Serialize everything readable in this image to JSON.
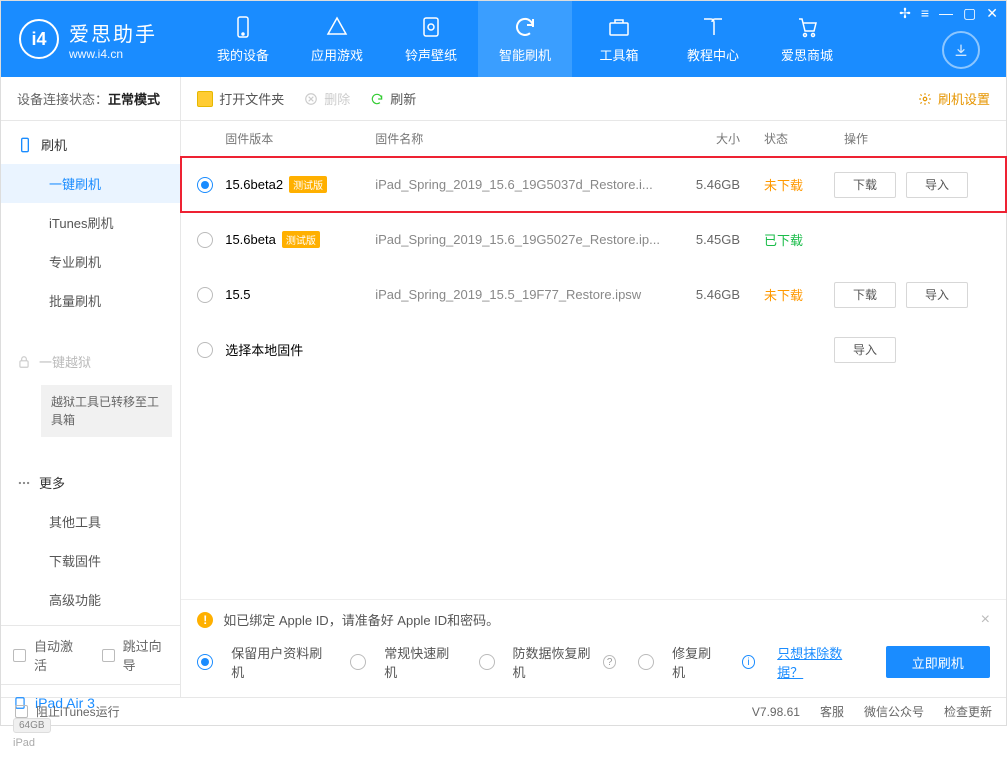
{
  "app": {
    "name": "爱思助手",
    "url": "www.i4.cn",
    "logo_char": "i4"
  },
  "winctrls": [
    "⬚",
    "≡",
    "—",
    "▢",
    "✕"
  ],
  "tabs": [
    {
      "label": "我的设备"
    },
    {
      "label": "应用游戏"
    },
    {
      "label": "铃声壁纸"
    },
    {
      "label": "智能刷机"
    },
    {
      "label": "工具箱"
    },
    {
      "label": "教程中心"
    },
    {
      "label": "爱思商城"
    }
  ],
  "conn": {
    "label": "设备连接状态：",
    "value": "正常模式"
  },
  "side": {
    "flash_header": "刷机",
    "items": [
      "一键刷机",
      "iTunes刷机",
      "专业刷机",
      "批量刷机"
    ],
    "jailbreak": "一键越狱",
    "jailbreak_note": "越狱工具已转移至工具箱",
    "more_header": "更多",
    "more_items": [
      "其他工具",
      "下载固件",
      "高级功能"
    ]
  },
  "auto_activate": "自动激活",
  "skip_guide": "跳过向导",
  "device": {
    "name": "iPad Air 3",
    "capacity": "64GB",
    "type": "iPad"
  },
  "toolbar": {
    "open": "打开文件夹",
    "delete": "删除",
    "refresh": "刷新",
    "settings": "刷机设置"
  },
  "cols": {
    "version": "固件版本",
    "name": "固件名称",
    "size": "大小",
    "status": "状态",
    "ops": "操作"
  },
  "rows": [
    {
      "selected": true,
      "version": "15.6beta2",
      "beta": "测试版",
      "name": "iPad_Spring_2019_15.6_19G5037d_Restore.i...",
      "size": "5.46GB",
      "status": "未下载",
      "status_class": "orange",
      "download": true,
      "import": true,
      "highlight": true
    },
    {
      "selected": false,
      "version": "15.6beta",
      "beta": "测试版",
      "name": "iPad_Spring_2019_15.6_19G5027e_Restore.ip...",
      "size": "5.45GB",
      "status": "已下载",
      "status_class": "green",
      "download": false,
      "import": false
    },
    {
      "selected": false,
      "version": "15.5",
      "beta": "",
      "name": "iPad_Spring_2019_15.5_19F77_Restore.ipsw",
      "size": "5.46GB",
      "status": "未下载",
      "status_class": "orange",
      "download": true,
      "import": true
    },
    {
      "selected": false,
      "version": "选择本地固件",
      "beta": "",
      "name": "",
      "size": "",
      "status": "",
      "status_class": "",
      "download": false,
      "import": true
    }
  ],
  "btn_labels": {
    "download": "下载",
    "import": "导入"
  },
  "notice": "如已绑定 Apple ID，请准备好 Apple ID和密码。",
  "flash_opts": [
    "保留用户资料刷机",
    "常规快速刷机",
    "防数据恢复刷机",
    "修复刷机"
  ],
  "erase_link": "只想抹除数据？",
  "flash_btn": "立即刷机",
  "statusbar": {
    "block": "阻止iTunes运行",
    "version": "V7.98.61",
    "links": [
      "客服",
      "微信公众号",
      "检查更新"
    ]
  }
}
